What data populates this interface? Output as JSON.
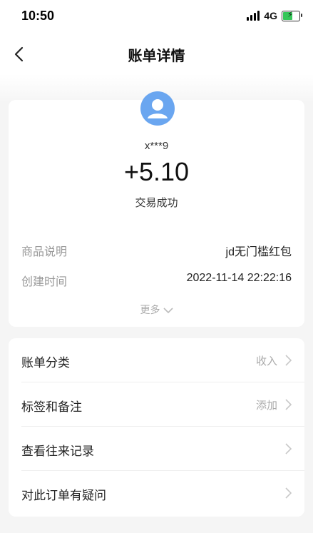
{
  "status_bar": {
    "time": "10:50",
    "network": "4G"
  },
  "header": {
    "title": "账单详情"
  },
  "summary": {
    "username": "x***9",
    "amount": "+5.10",
    "status": "交易成功"
  },
  "details": {
    "product_label": "商品说明",
    "product_value": "jd无门槛红包",
    "created_label": "创建时间",
    "created_value": "2022-11-14 22:22:16",
    "more_label": "更多"
  },
  "list": {
    "items": [
      {
        "label": "账单分类",
        "value": "收入"
      },
      {
        "label": "标签和备注",
        "value": "添加"
      },
      {
        "label": "查看往来记录",
        "value": ""
      },
      {
        "label": "对此订单有疑问",
        "value": ""
      }
    ]
  },
  "colors": {
    "avatar": "#6aa6f0",
    "battery": "#35c759",
    "background": "#f5f5f5"
  }
}
